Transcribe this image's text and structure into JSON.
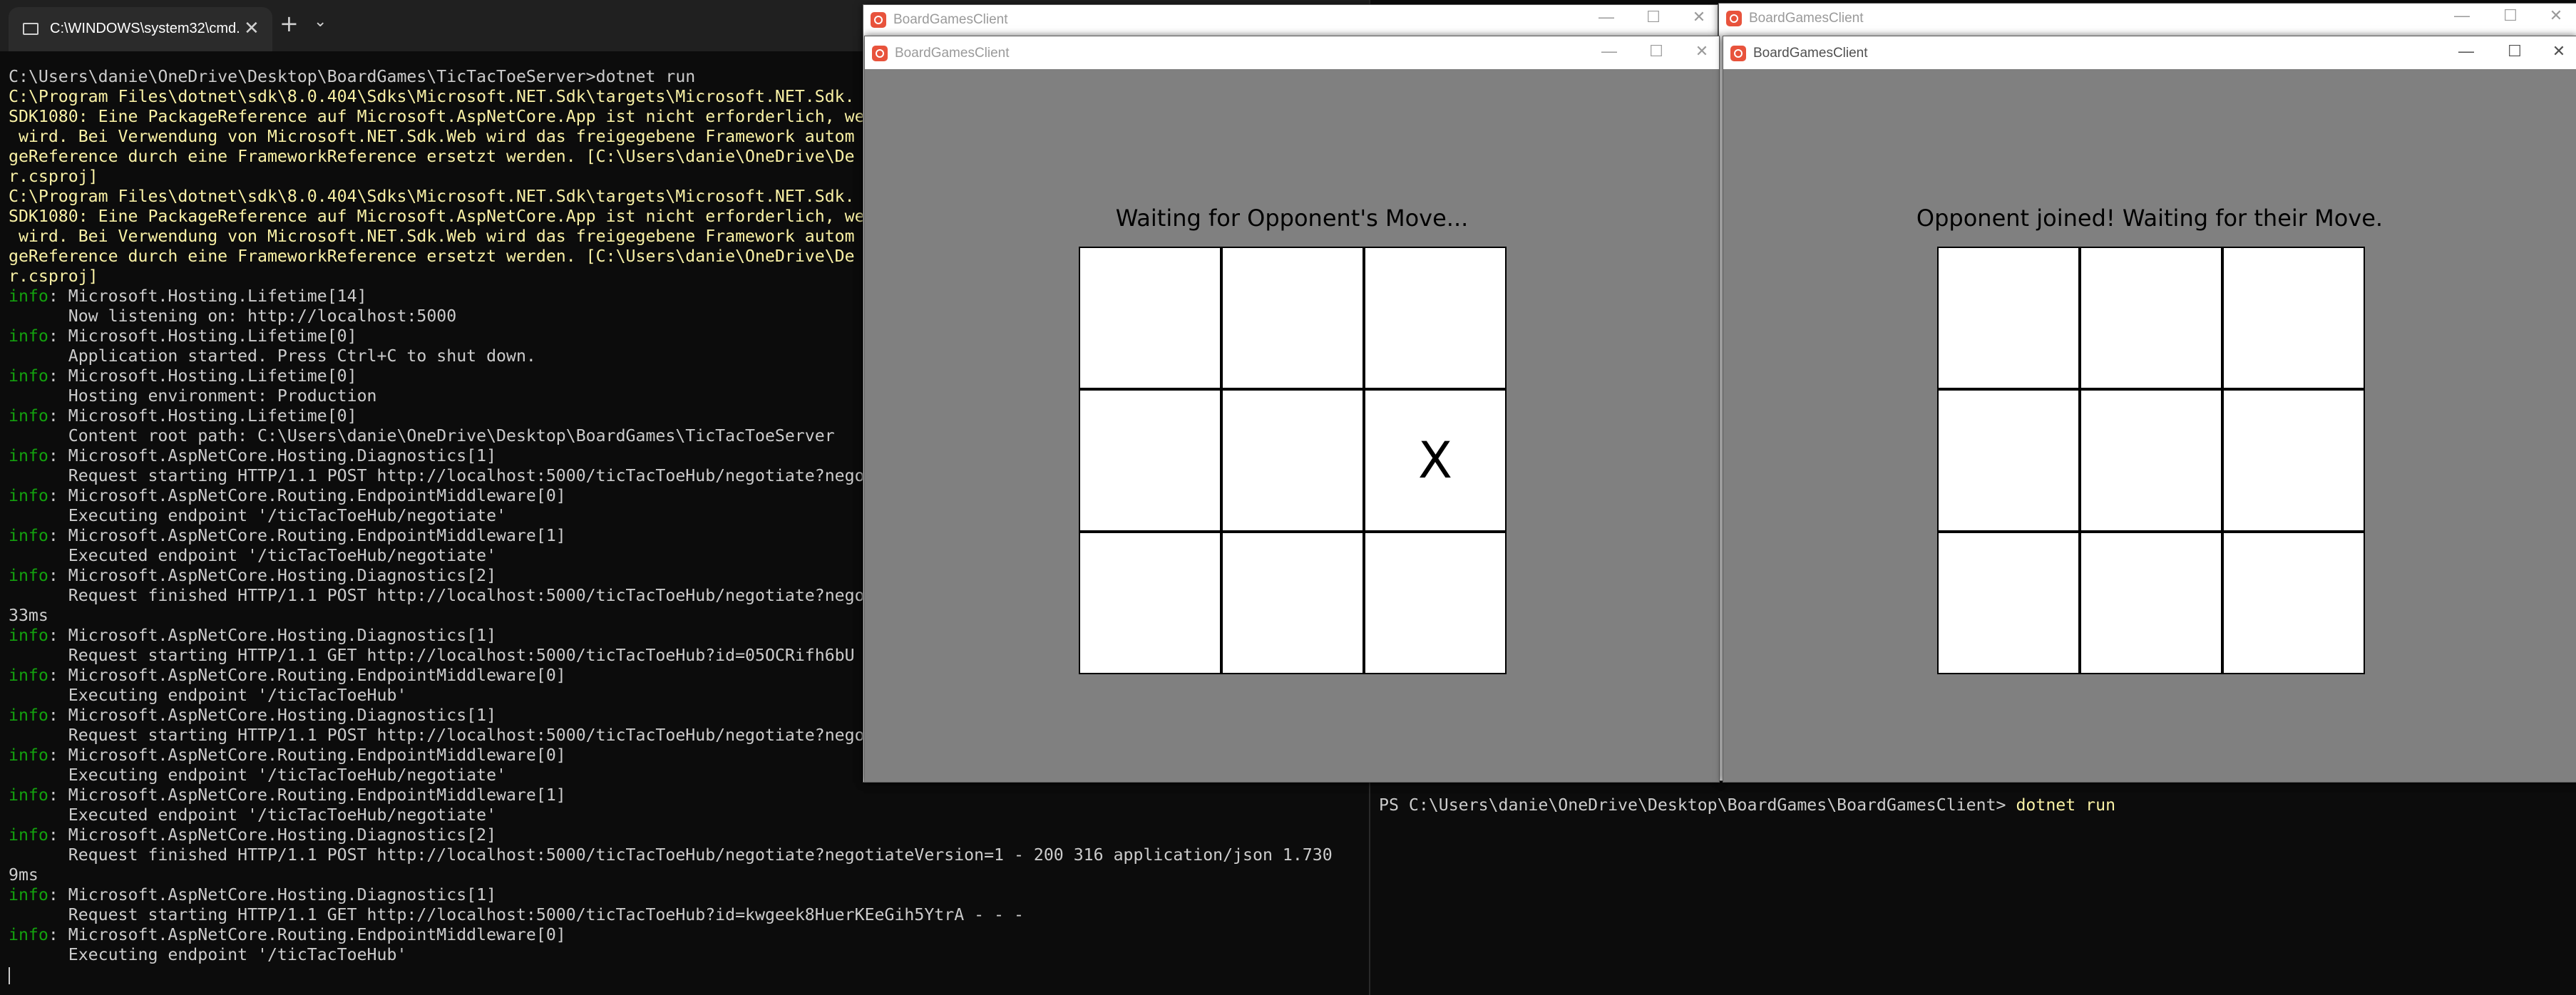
{
  "left_terminal": {
    "tab_title": "C:\\WINDOWS\\system32\\cmd.",
    "tab_close_icon": "✕",
    "new_tab_icon": "+",
    "dropdown_icon": "⌄",
    "lines": [
      {
        "label": "",
        "text": "C:\\Users\\danie\\OneDrive\\Desktop\\BoardGames\\TicTacToeServer>dotnet run",
        "color": "default"
      },
      {
        "label": "",
        "text": "C:\\Program Files\\dotnet\\sdk\\8.0.404\\Sdks\\Microsoft.NET.Sdk\\targets\\Microsoft.NET.Sdk.",
        "color": "yellow"
      },
      {
        "label": "",
        "text": "SDK1080: Eine PackageReference auf Microsoft.AspNetCore.App ist nicht erforderlich, we",
        "color": "yellow"
      },
      {
        "label": "",
        "text": " wird. Bei Verwendung von Microsoft.NET.Sdk.Web wird das freigegebene Framework autom",
        "color": "yellow"
      },
      {
        "label": "",
        "text": "geReference durch eine FrameworkReference ersetzt werden. [C:\\Users\\danie\\OneDrive\\De",
        "color": "yellow"
      },
      {
        "label": "",
        "text": "r.csproj]",
        "color": "yellow"
      },
      {
        "label": "",
        "text": "C:\\Program Files\\dotnet\\sdk\\8.0.404\\Sdks\\Microsoft.NET.Sdk\\targets\\Microsoft.NET.Sdk.",
        "color": "yellow"
      },
      {
        "label": "",
        "text": "SDK1080: Eine PackageReference auf Microsoft.AspNetCore.App ist nicht erforderlich, we",
        "color": "yellow"
      },
      {
        "label": "",
        "text": " wird. Bei Verwendung von Microsoft.NET.Sdk.Web wird das freigegebene Framework autom",
        "color": "yellow"
      },
      {
        "label": "",
        "text": "geReference durch eine FrameworkReference ersetzt werden. [C:\\Users\\danie\\OneDrive\\De",
        "color": "yellow"
      },
      {
        "label": "",
        "text": "r.csproj]",
        "color": "yellow"
      },
      {
        "label": "info",
        "text": ": Microsoft.Hosting.Lifetime[14]",
        "color": "default"
      },
      {
        "label": "",
        "text": "      Now listening on: http://localhost:5000",
        "color": "default"
      },
      {
        "label": "info",
        "text": ": Microsoft.Hosting.Lifetime[0]",
        "color": "default"
      },
      {
        "label": "",
        "text": "      Application started. Press Ctrl+C to shut down.",
        "color": "default"
      },
      {
        "label": "info",
        "text": ": Microsoft.Hosting.Lifetime[0]",
        "color": "default"
      },
      {
        "label": "",
        "text": "      Hosting environment: Production",
        "color": "default"
      },
      {
        "label": "info",
        "text": ": Microsoft.Hosting.Lifetime[0]",
        "color": "default"
      },
      {
        "label": "",
        "text": "      Content root path: C:\\Users\\danie\\OneDrive\\Desktop\\BoardGames\\TicTacToeServer",
        "color": "default"
      },
      {
        "label": "info",
        "text": ": Microsoft.AspNetCore.Hosting.Diagnostics[1]",
        "color": "default"
      },
      {
        "label": "",
        "text": "      Request starting HTTP/1.1 POST http://localhost:5000/ticTacToeHub/negotiate?nego",
        "color": "default"
      },
      {
        "label": "info",
        "text": ": Microsoft.AspNetCore.Routing.EndpointMiddleware[0]",
        "color": "default"
      },
      {
        "label": "",
        "text": "      Executing endpoint '/ticTacToeHub/negotiate'",
        "color": "default"
      },
      {
        "label": "info",
        "text": ": Microsoft.AspNetCore.Routing.EndpointMiddleware[1]",
        "color": "default"
      },
      {
        "label": "",
        "text": "      Executed endpoint '/ticTacToeHub/negotiate'",
        "color": "default"
      },
      {
        "label": "info",
        "text": ": Microsoft.AspNetCore.Hosting.Diagnostics[2]",
        "color": "default"
      },
      {
        "label": "",
        "text": "      Request finished HTTP/1.1 POST http://localhost:5000/ticTacToeHub/negotiate?nego",
        "color": "default"
      },
      {
        "label": "",
        "text": "33ms",
        "color": "default"
      },
      {
        "label": "info",
        "text": ": Microsoft.AspNetCore.Hosting.Diagnostics[1]",
        "color": "default"
      },
      {
        "label": "",
        "text": "      Request starting HTTP/1.1 GET http://localhost:5000/ticTacToeHub?id=05OCRifh6bU",
        "color": "default"
      },
      {
        "label": "info",
        "text": ": Microsoft.AspNetCore.Routing.EndpointMiddleware[0]",
        "color": "default"
      },
      {
        "label": "",
        "text": "      Executing endpoint '/ticTacToeHub'",
        "color": "default"
      },
      {
        "label": "info",
        "text": ": Microsoft.AspNetCore.Hosting.Diagnostics[1]",
        "color": "default"
      },
      {
        "label": "",
        "text": "      Request starting HTTP/1.1 POST http://localhost:5000/ticTacToeHub/negotiate?nego",
        "color": "default"
      },
      {
        "label": "info",
        "text": ": Microsoft.AspNetCore.Routing.EndpointMiddleware[0]",
        "color": "default"
      },
      {
        "label": "",
        "text": "      Executing endpoint '/ticTacToeHub/negotiate'",
        "color": "default"
      },
      {
        "label": "info",
        "text": ": Microsoft.AspNetCore.Routing.EndpointMiddleware[1]",
        "color": "default"
      },
      {
        "label": "",
        "text": "      Executed endpoint '/ticTacToeHub/negotiate'",
        "color": "default"
      },
      {
        "label": "info",
        "text": ": Microsoft.AspNetCore.Hosting.Diagnostics[2]",
        "color": "default"
      },
      {
        "label": "",
        "text": "      Request finished HTTP/1.1 POST http://localhost:5000/ticTacToeHub/negotiate?negotiateVersion=1 - 200 316 application/json 1.730",
        "color": "default"
      },
      {
        "label": "",
        "text": "9ms",
        "color": "default"
      },
      {
        "label": "info",
        "text": ": Microsoft.AspNetCore.Hosting.Diagnostics[1]",
        "color": "default"
      },
      {
        "label": "",
        "text": "      Request starting HTTP/1.1 GET http://localhost:5000/ticTacToeHub?id=kwgeek8HuerKEeGih5YtrA - - -",
        "color": "default"
      },
      {
        "label": "info",
        "text": ": Microsoft.AspNetCore.Routing.EndpointMiddleware[0]",
        "color": "default"
      },
      {
        "label": "",
        "text": "      Executing endpoint '/ticTacToeHub'",
        "color": "default"
      }
    ]
  },
  "right_terminal": {
    "prompt": "PS C:\\Users\\danie\\OneDrive\\Desktop\\BoardGames\\BoardGamesClient> ",
    "command": "dotnet run"
  },
  "windows": {
    "behind_left": {
      "title": "BoardGamesClient"
    },
    "behind_right": {
      "title": "BoardGamesClient"
    },
    "game_left": {
      "title": "BoardGamesClient",
      "status": "Waiting for Opponent's Move...",
      "board": [
        "",
        "",
        "",
        "",
        "",
        "X",
        "",
        "",
        ""
      ]
    },
    "game_right": {
      "title": "BoardGamesClient",
      "status": "Opponent joined! Waiting for their Move.",
      "board": [
        "",
        "",
        "",
        "",
        "",
        "",
        "",
        "",
        ""
      ]
    },
    "controls": {
      "minimize": "—",
      "maximize": "☐",
      "close": "✕"
    }
  },
  "colors": {
    "terminal_bg": "#0c0c0c",
    "warning_yellow": "#f9f1a5",
    "info_green": "#13a10e",
    "game_bg": "#808080"
  }
}
